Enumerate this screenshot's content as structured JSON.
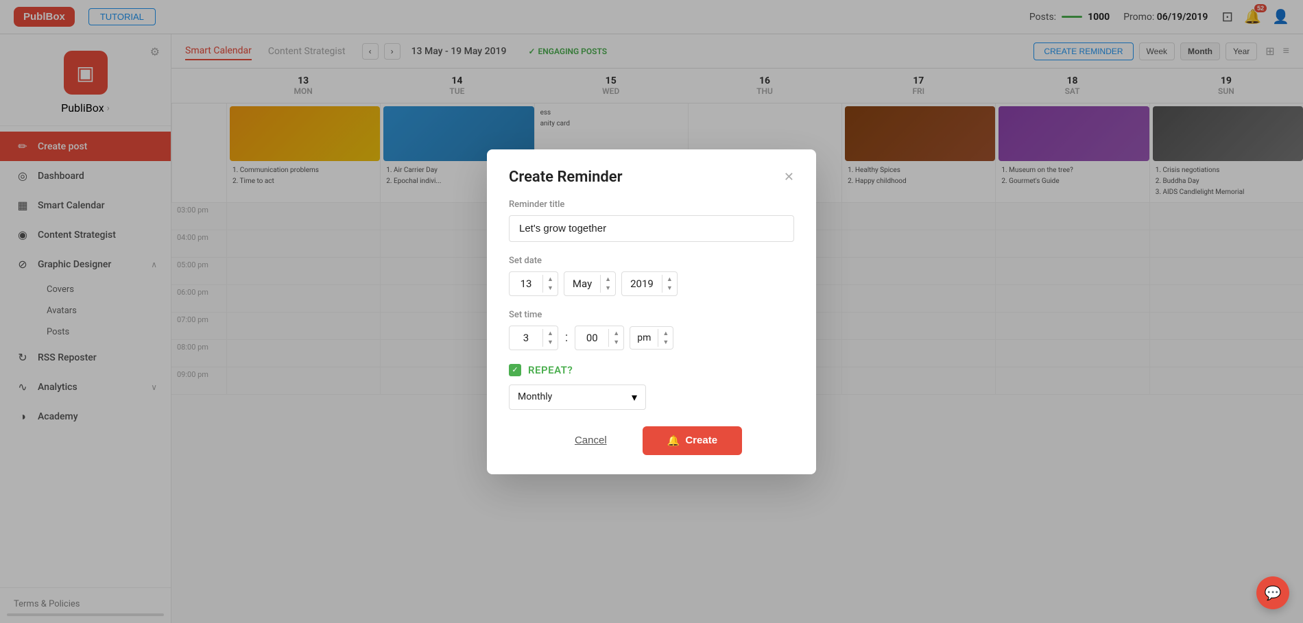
{
  "header": {
    "logo": "PublBox",
    "tutorial_label": "TUTORIAL",
    "posts_label": "Posts:",
    "posts_count": "1000",
    "promo_label": "Promo:",
    "promo_date": "06/19/2019",
    "notification_badge": "52"
  },
  "sidebar": {
    "profile_name": "PubliBox",
    "nav_items": [
      {
        "id": "create-post",
        "label": "Create post",
        "icon": "✏",
        "active": true
      },
      {
        "id": "dashboard",
        "label": "Dashboard",
        "icon": "◎"
      },
      {
        "id": "smart-calendar",
        "label": "Smart Calendar",
        "icon": "▦"
      },
      {
        "id": "content-strategist",
        "label": "Content Strategist",
        "icon": "◉"
      },
      {
        "id": "graphic-designer",
        "label": "Graphic Designer",
        "icon": "⊘",
        "expanded": true
      },
      {
        "id": "rss-reposter",
        "label": "RSS Reposter",
        "icon": "↻"
      },
      {
        "id": "analytics",
        "label": "Analytics",
        "icon": "∿",
        "has_arrow": true
      },
      {
        "id": "academy",
        "label": "Academy",
        "icon": "◑"
      }
    ],
    "graphic_sub_items": [
      "Covers",
      "Avatars",
      "Posts"
    ],
    "terms_label": "Terms & Policies"
  },
  "calendar": {
    "tabs": [
      "Smart Calendar",
      "Content Strategist"
    ],
    "active_tab": "Smart Calendar",
    "date_range": "13 May - 19 May 2019",
    "engaging_label": "ENGAGING POSTS",
    "view_buttons": [
      "Week",
      "Month",
      "Year"
    ],
    "active_view": "Month",
    "create_reminder_label": "CREATE REMINDER",
    "col_headers": [
      {
        "day": "MON",
        "num": "13"
      },
      {
        "day": "TUE",
        "num": "14"
      },
      {
        "day": "WED",
        "num": "15"
      },
      {
        "day": "THU",
        "num": "16"
      },
      {
        "day": "FRI",
        "num": "17"
      },
      {
        "day": "SAT",
        "num": "18"
      },
      {
        "day": "SUN",
        "num": "19"
      }
    ],
    "time_slots": [
      "03:00 pm",
      "04:00 pm",
      "05:00 pm",
      "06:00 pm",
      "07:00 pm",
      "08:00 pm",
      "09:00 pm"
    ],
    "mon_events": [
      "1. Communication problems",
      "2. Time to act"
    ],
    "tue_events": [
      "1. Air Carrier Day",
      "2. Epochal indivi..."
    ],
    "wed_events": [
      "ess",
      "anity card"
    ],
    "fri_events": [
      "1. Healthy Spices",
      "2. Happy childhood"
    ],
    "sat_events": [
      "1. Museum on the tree?",
      "2. Gourmet's Guide"
    ],
    "sun_events": [
      "1. Crisis negotiations",
      "2. Buddha Day",
      "3. AIDS Candlelight Memorial"
    ]
  },
  "modal": {
    "title": "Create Reminder",
    "title_label": "Reminder title",
    "title_value": "Let's grow together",
    "date_label": "Set date",
    "date_day": "13",
    "date_month": "May",
    "date_year": "2019",
    "time_label": "Set time",
    "time_hour": "3",
    "time_minute": "00",
    "time_ampm": "pm",
    "repeat_label": "REPEAT?",
    "repeat_value": "Monthly",
    "cancel_label": "Cancel",
    "create_label": "Create"
  },
  "chat_bubble": {
    "icon": "💬"
  }
}
